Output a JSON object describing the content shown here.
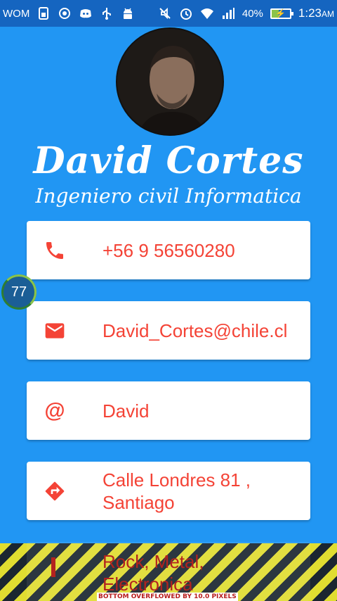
{
  "status_bar": {
    "carrier": "WOM",
    "battery_percent": "40%",
    "time": "1:23",
    "time_suffix": "AM",
    "battery_level": 0.4,
    "icons_left": [
      "sim-icon",
      "radio-icon",
      "discord-icon",
      "usb-icon",
      "android-icon"
    ],
    "icons_right": [
      "mute-icon",
      "alarm-icon",
      "wifi-icon",
      "signal-icon",
      "battery-charging-icon"
    ]
  },
  "profile": {
    "name": "David Cortes",
    "title": "Ingeniero civil Informatica"
  },
  "cards": [
    {
      "icon": "phone-icon",
      "text": "+56 9 56560280"
    },
    {
      "icon": "email-icon",
      "text": "David_Cortes@chile.cl"
    },
    {
      "icon": "at-icon",
      "icon_glyph": "@",
      "text": "David"
    },
    {
      "icon": "directions-icon",
      "text_line1": "Calle Londres 81 ,",
      "text_line2": "Santiago"
    },
    {
      "icon": "music-icon",
      "text_line1": "Rock, Metal,",
      "text_line2": "Electronica"
    }
  ],
  "floating_badge": {
    "value": "77"
  },
  "overflow_warning": "BOTTOM OVERFLOWED BY 10.0 PIXELS",
  "colors": {
    "background": "#2196f3",
    "statusbar": "#1565c0",
    "accent": "#f44336",
    "card": "#ffffff"
  }
}
